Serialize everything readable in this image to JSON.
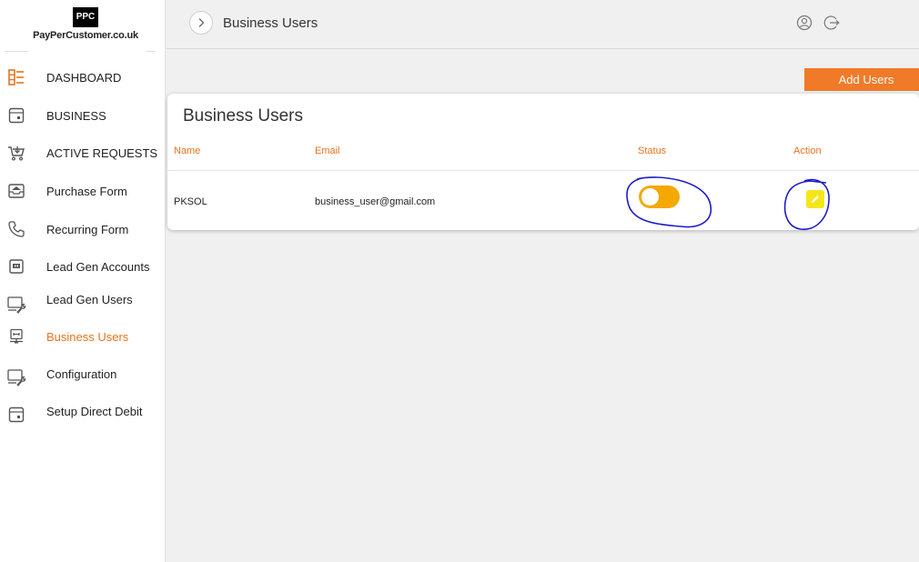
{
  "brand": {
    "logo_mark": "PPC",
    "name": "PayPerCustomer.co.uk"
  },
  "sidebar": {
    "items": [
      {
        "label": "DASHBOARD",
        "icon": "dashboard-icon",
        "active": false
      },
      {
        "label": "BUSINESS",
        "icon": "building-icon",
        "active": false
      },
      {
        "label": "ACTIVE REQUESTS",
        "icon": "cart-icon",
        "active": false
      },
      {
        "label": "Purchase Form",
        "icon": "inbox-tray-icon",
        "active": false
      },
      {
        "label": "Recurring Form",
        "icon": "phone-icon",
        "active": false
      },
      {
        "label": "Lead Gen Accounts",
        "icon": "id-card-icon",
        "active": false
      },
      {
        "label": "Lead Gen Users",
        "icon": "monitor-wrench-icon",
        "active": false
      },
      {
        "label": "Business Users",
        "icon": "network-monitor-icon",
        "active": true
      },
      {
        "label": "Configuration",
        "icon": "monitor-wrench-icon",
        "active": false
      },
      {
        "label": "Setup Direct Debit",
        "icon": "building-icon",
        "active": false
      }
    ]
  },
  "header": {
    "title": "Business Users",
    "icons": [
      "user-circle-icon",
      "logout-icon"
    ]
  },
  "toolbar": {
    "add_label": "Add Users"
  },
  "table": {
    "title": "Business Users",
    "columns": [
      "Name",
      "Email",
      "Status",
      "Action"
    ],
    "rows": [
      {
        "name": "PKSOL",
        "email": "business_user@gmail.com",
        "status_on": true,
        "action_icon": "edit-pencil-icon"
      }
    ]
  },
  "colors": {
    "accent": "#e8731e",
    "button": "#f07a28",
    "toggle": "#f5a800",
    "edit": "#f5e61a",
    "annotation": "#1c1cc8"
  }
}
